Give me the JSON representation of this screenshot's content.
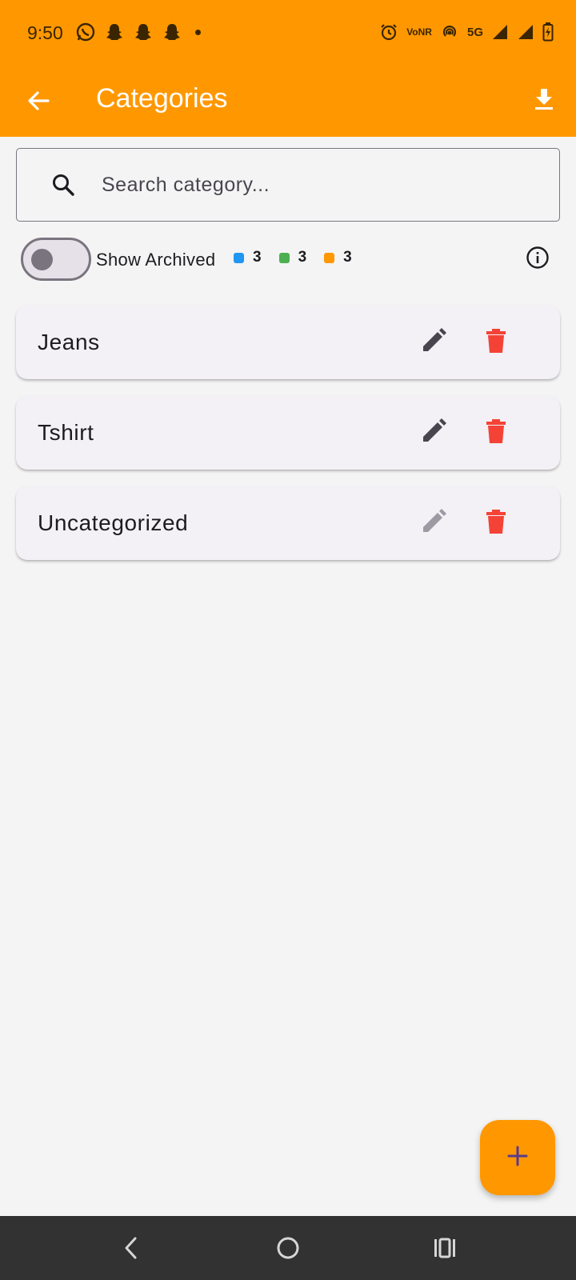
{
  "status_bar": {
    "time": "9:50",
    "left_icons": [
      "whatsapp-icon",
      "snapchat-icon",
      "snapchat-icon",
      "snapchat-icon",
      "notification-dot"
    ],
    "volte_label_top": "Vo",
    "volte_label_bottom": "NR",
    "network_label": "5G",
    "right_icons": [
      "alarm-icon",
      "volte-icon",
      "hotspot-icon",
      "5g-icon",
      "signal-icon",
      "signal-icon",
      "battery-icon"
    ]
  },
  "app_bar": {
    "title": "Categories",
    "back_icon": "arrow-back-icon",
    "download_icon": "download-icon"
  },
  "search": {
    "placeholder": "Search category...",
    "value": ""
  },
  "filters": {
    "show_archived_label": "Show Archived",
    "show_archived_on": false,
    "legend": [
      {
        "color": "#2196f3",
        "count": "3"
      },
      {
        "color": "#4caf50",
        "count": "3"
      },
      {
        "color": "#ff9800",
        "count": "3"
      }
    ]
  },
  "categories": [
    {
      "name": "Jeans",
      "editable": true
    },
    {
      "name": "Tshirt",
      "editable": true
    },
    {
      "name": "Uncategorized",
      "editable": false
    }
  ],
  "colors": {
    "accent": "#ff9800",
    "delete": "#f44336",
    "edit": "#49454f",
    "edit_disabled": "#9e9aa3",
    "card_bg": "#f3f0f6",
    "nav_bar": "#323232"
  },
  "fab": {
    "icon": "plus-icon"
  },
  "nav_bar": {
    "icons": [
      "back-nav-icon",
      "home-nav-icon",
      "recents-nav-icon"
    ]
  }
}
